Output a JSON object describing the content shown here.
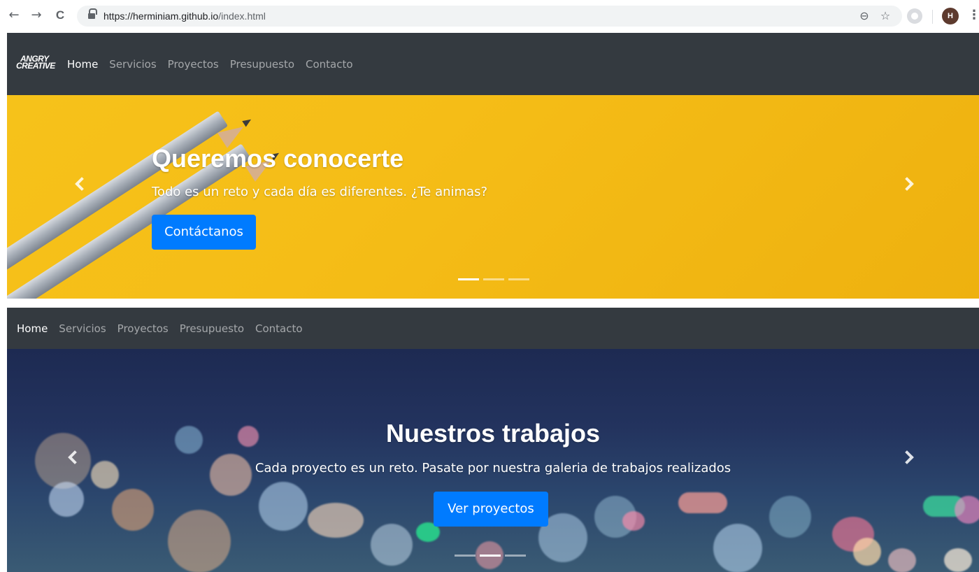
{
  "browser": {
    "url_host": "https://herminiam.github.io",
    "url_path": "/index.html",
    "avatar_initial": "H",
    "back_icon": "←",
    "forward_icon": "→",
    "reload_icon": "C",
    "zoom_icon": "⊖",
    "star_icon": "☆",
    "menu_icon": "⋮"
  },
  "logo": {
    "line1": "ANGRY",
    "line2": "CREATIVE"
  },
  "navbar": {
    "items": [
      {
        "label": "Home",
        "active": true
      },
      {
        "label": "Servicios",
        "active": false
      },
      {
        "label": "Proyectos",
        "active": false
      },
      {
        "label": "Presupuesto",
        "active": false
      },
      {
        "label": "Contacto",
        "active": false
      }
    ]
  },
  "hero1": {
    "title": "Queremos conocerte",
    "subtitle": "Todo es un reto y cada día es diferentes. ¿Te animas?",
    "button": "Contáctanos",
    "active_slide": 1,
    "background_color": "#f5bd17"
  },
  "hero2": {
    "title": "Nuestros trabajos",
    "subtitle": "Cada proyecto es un reto. Pasate por nuestra galeria de trabajos realizados",
    "button": "Ver proyectos",
    "active_slide": 2,
    "background_color": "#23335e"
  },
  "colors": {
    "navbar": "#343a40",
    "primary": "#007bff"
  }
}
